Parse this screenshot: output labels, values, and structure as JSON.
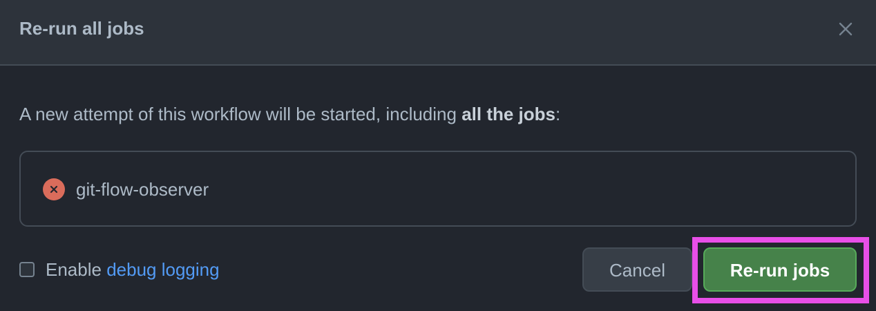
{
  "dialog": {
    "title": "Re-run all jobs",
    "close_icon": "close-icon"
  },
  "description": {
    "prefix": "A new attempt of this workflow will be started, including ",
    "emphasis": "all the jobs",
    "suffix": ":"
  },
  "jobs": [
    {
      "name": "git-flow-observer",
      "status": "failed",
      "status_icon": "x-circle-icon",
      "status_color": "#da6c5b"
    }
  ],
  "debug": {
    "checked": false,
    "label_prefix": "Enable ",
    "link_text": "debug logging"
  },
  "actions": {
    "cancel_label": "Cancel",
    "rerun_label": "Re-run jobs"
  },
  "colors": {
    "primary_button": "#46824a",
    "link": "#539bf5",
    "highlight": "#e84fe8"
  }
}
